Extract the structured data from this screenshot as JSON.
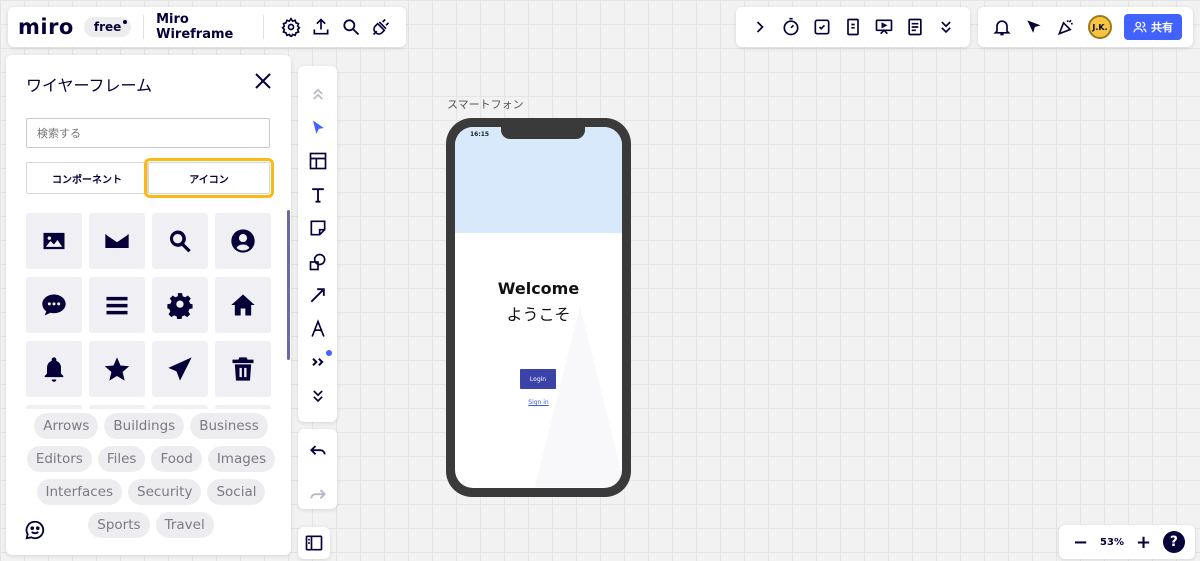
{
  "app": {
    "logo": "miro",
    "plan_badge": "free",
    "board_name": "Miro Wireframe"
  },
  "top_toolbar": {
    "left_icons": [
      "settings-icon",
      "upload-icon",
      "search-icon",
      "plugin-icon"
    ],
    "right_tools": [
      "expand-arrow-icon",
      "timer-icon",
      "voting-icon",
      "card-icon",
      "present-icon",
      "notes-icon",
      "more-chevron-icon"
    ],
    "collab_icons": [
      "bell-icon",
      "cursor-icon",
      "celebrate-icon"
    ],
    "avatar_initials": "J.K.",
    "share_label": "共有"
  },
  "left_panel": {
    "title": "ワイヤーフレーム",
    "search_placeholder": "検索する",
    "tabs": [
      "コンポーネント",
      "アイコン"
    ],
    "active_tab": "アイコン",
    "icons": [
      "image-icon",
      "mail-icon",
      "search-icon",
      "user-icon",
      "chat-icon",
      "menu-icon",
      "gear-icon",
      "home-icon",
      "bell-icon",
      "star-icon",
      "send-icon",
      "trash-icon"
    ],
    "categories": [
      "Arrows",
      "Buildings",
      "Business",
      "Editors",
      "Files",
      "Food",
      "Images",
      "Interfaces",
      "Security",
      "Social",
      "Sports",
      "Travel"
    ]
  },
  "vertical_toolbar": {
    "tools": [
      "collapse-up-icon",
      "select-icon",
      "template-icon",
      "text-icon",
      "sticky-note-icon",
      "shapes-icon",
      "line-arrow-icon",
      "pen-icon",
      "more-tools-icon",
      "expand-down-icon"
    ],
    "history": [
      "undo-icon",
      "redo-icon"
    ]
  },
  "canvas": {
    "frame_label": "スマートフォン",
    "phone": {
      "status_time": "16:15",
      "heading": "Welcome",
      "subheading": "ようこそ",
      "button_label": "Login",
      "link_label": "Sign in"
    }
  },
  "zoom": {
    "level": "53%",
    "minus": "−",
    "plus": "+",
    "help": "?"
  },
  "colors": {
    "accent": "#4262ff",
    "highlight": "#fdb913",
    "ink": "#050038"
  }
}
